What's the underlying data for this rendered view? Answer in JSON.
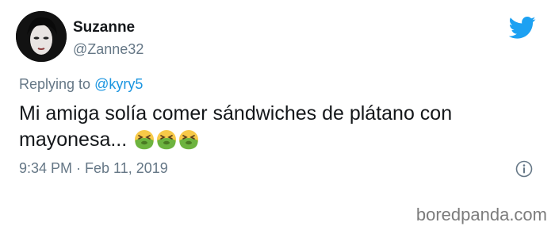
{
  "tweet": {
    "author_name": "Suzanne",
    "author_handle": "@Zanne32",
    "replying_prefix": "Replying to ",
    "replying_to": "@kyry5",
    "text": "Mi amiga solía comer sándwiches de plátano con mayonesa...",
    "emojis": [
      "nauseated-face-icon",
      "nauseated-face-icon",
      "nauseated-face-icon"
    ],
    "timestamp": "9:34 PM · Feb 11, 2019"
  },
  "icons": {
    "brand": "twitter-bird-icon",
    "info": "info-icon"
  },
  "watermark": "boredpanda.com",
  "colors": {
    "twitter_blue": "#1da1f2",
    "mention_blue": "#1b95e0",
    "secondary_text": "#657786",
    "emoji_green": "#6db33f"
  }
}
